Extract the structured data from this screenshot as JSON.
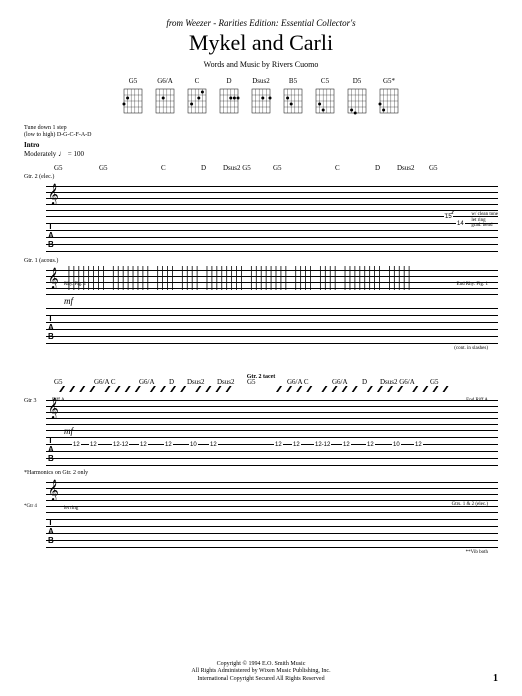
{
  "header": {
    "from_line": "from Weezer - Rarities Edition: Essential Collector's",
    "title": "Mykel and Carli",
    "byline": "Words and Music by Rivers Cuomo"
  },
  "chord_diagrams": [
    {
      "name": "G5"
    },
    {
      "name": "G6/A"
    },
    {
      "name": "C"
    },
    {
      "name": "D"
    },
    {
      "name": "Dsus2"
    },
    {
      "name": "B5"
    },
    {
      "name": "C5"
    },
    {
      "name": "D5"
    },
    {
      "name": "G5*"
    }
  ],
  "tuning": {
    "line1": "Tune down 1 step",
    "line2": "(low to high) D-G-C-F-A-D"
  },
  "tempo": {
    "section": "Intro",
    "marking": "Moderately",
    "bpm": "100"
  },
  "system1": {
    "chords": [
      "G5",
      "G5",
      "C",
      "D",
      "Dsus2 G5",
      "G5",
      "C",
      "D",
      "Dsus2",
      "G5"
    ],
    "gtr2_label": "Gtr. 2 (elec.)",
    "gtr1_label": "Gtr. 1 (acous.)",
    "rhy_fig": "Rhy. Fig. 1",
    "end_rhy_fig": "End Rhy. Fig. 1",
    "dyn": "mf",
    "side_notes": [
      "w/ clean tone",
      "let ring",
      "grad. bend"
    ],
    "tab_nums_top": [
      "15",
      "14"
    ],
    "tacet_note": "(cont. in slashes)"
  },
  "system2": {
    "chords": [
      "G5",
      "G6/A C",
      "G6/A",
      "D",
      "Dsus2",
      "Dsus2",
      "G5",
      "G6/A C",
      "G6/A",
      "D",
      "Dsus2 G6/A",
      "G5"
    ],
    "gtr2_section": "Gtr. 2 tacet",
    "gtr1_riff": "Riff A",
    "gtr1_end_riff": "End Riff A",
    "dyn": "mf",
    "tab_nums": [
      "12",
      "12",
      "12-12",
      "12",
      "12",
      "10",
      "12",
      "12",
      "12",
      "12-12",
      "12",
      "12",
      "10",
      "12"
    ],
    "harm_label": "*Harmonics on Gtr. 2 only",
    "gtr3_label": "Gtr 3",
    "gtr4_label": "*Gtr 4",
    "gtrs12_label": "Gtrs. 1 & 2 (elec.)",
    "let_ring": "let ring",
    "vib_note": "**Vib both"
  },
  "footer": {
    "line1": "Copyright © 1994 E.O. Smith Music",
    "line2": "All Rights Administered by Wixen Music Publishing, Inc.",
    "line3": "International Copyright Secured   All Rights Reserved"
  },
  "page_number": "1"
}
